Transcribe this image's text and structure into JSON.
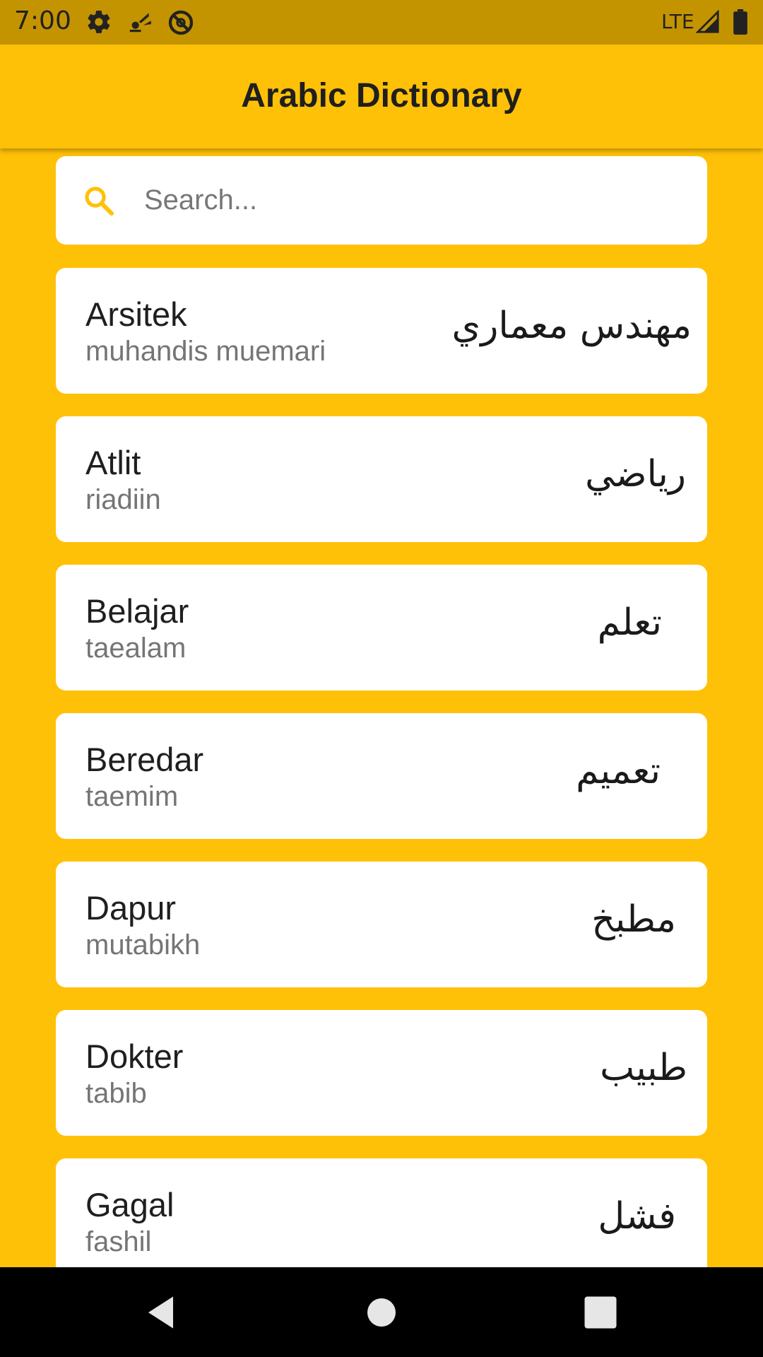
{
  "status_bar": {
    "time": "7:00",
    "network": "LTE",
    "icons": [
      "settings-icon",
      "signal-tower-icon",
      "blocked-icon",
      "cell-signal-icon",
      "battery-icon"
    ]
  },
  "app_bar": {
    "title": "Arabic Dictionary"
  },
  "search": {
    "placeholder": "Search...",
    "value": "",
    "icon": "search-icon"
  },
  "entries": [
    {
      "word": "Arsitek",
      "translit": "muhandis muemari",
      "arabic": "مهندس معماري"
    },
    {
      "word": "Atlit",
      "translit": "riadiin",
      "arabic": "رياضي"
    },
    {
      "word": "Belajar",
      "translit": "taealam",
      "arabic": "تعلم"
    },
    {
      "word": "Beredar",
      "translit": "taemim",
      "arabic": "تعميم"
    },
    {
      "word": "Dapur",
      "translit": "mutabikh",
      "arabic": "مطبخ"
    },
    {
      "word": "Dokter",
      "translit": "tabib",
      "arabic": "طبيب"
    },
    {
      "word": "Gagal",
      "translit": "fashil",
      "arabic": "فشل"
    }
  ],
  "nav_bar": {
    "buttons": [
      "back-icon",
      "home-icon",
      "recents-icon"
    ]
  },
  "colors": {
    "accent": "#FFC107",
    "status_bar": "#C49400",
    "card": "#FFFFFF",
    "title_text": "#1F1F1F",
    "secondary_text": "#757575"
  }
}
